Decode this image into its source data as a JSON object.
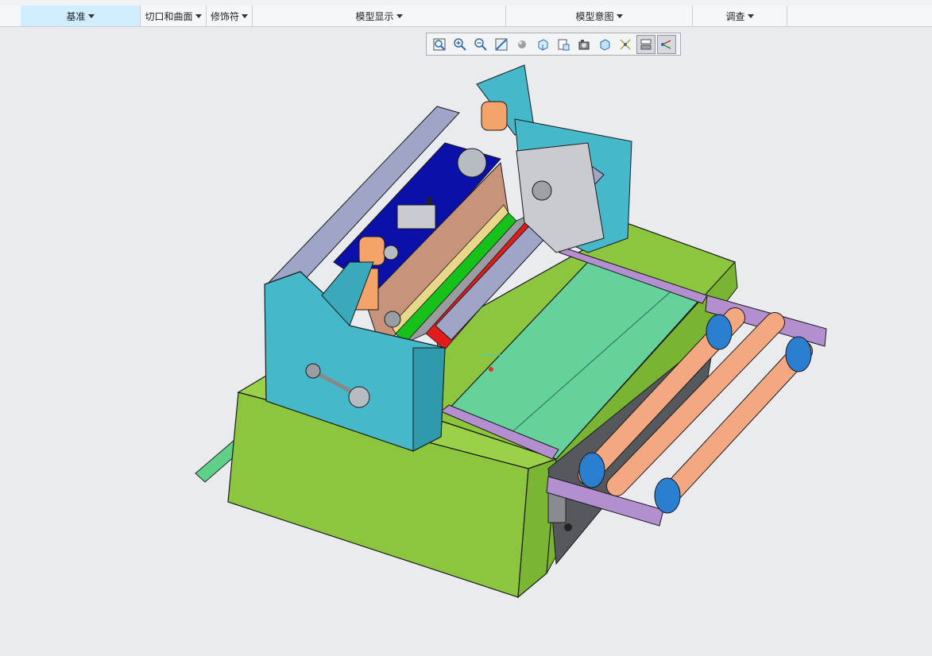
{
  "ribbon": {
    "groups": [
      {
        "label": "基准",
        "active": true
      },
      {
        "label": "切口和曲面",
        "active": false
      },
      {
        "label": "修饰符",
        "active": false
      },
      {
        "label": "模型显示",
        "active": false
      },
      {
        "label": "模型意图",
        "active": false
      },
      {
        "label": "调查",
        "active": false
      }
    ]
  },
  "toolbar": {
    "tools": [
      "refit-icon",
      "zoom-in-icon",
      "zoom-out-icon",
      "repaint-icon",
      "display-style-icon",
      "saved-views-icon",
      "view-manager-icon",
      "perspective-icon",
      "spin-center-icon",
      "datum-display-icon",
      "annotation-display-icon",
      "3d-dragger-icon"
    ]
  },
  "colors": {
    "background": "#e9ebee",
    "base": "#8cc63f",
    "frame": "#45b8c9",
    "rollers": "#f4a882",
    "roller_rings": "#2a7fd0",
    "plate": "#64d29a",
    "brackets": "#b48fd0"
  }
}
